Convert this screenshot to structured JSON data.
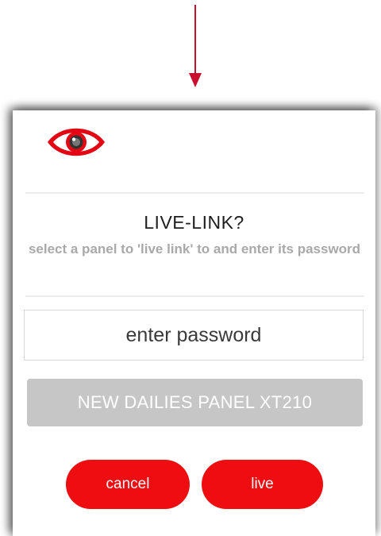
{
  "colors": {
    "accent": "#ee0d10",
    "arrow": "#c8102e",
    "subtitle": "#a9a9a9",
    "panel_select_bg": "#c6c6c6"
  },
  "pointer": {
    "icon": "down-arrow-icon"
  },
  "dialog": {
    "logo_icon": "eye-icon",
    "title": "LIVE-LINK?",
    "subtitle": "select a panel to 'live link' to and enter its password",
    "password": {
      "value": "",
      "placeholder": "enter password"
    },
    "panel_select": {
      "selected": "NEW DAILIES PANEL XT210"
    },
    "buttons": {
      "cancel": "cancel",
      "live": "live"
    }
  }
}
